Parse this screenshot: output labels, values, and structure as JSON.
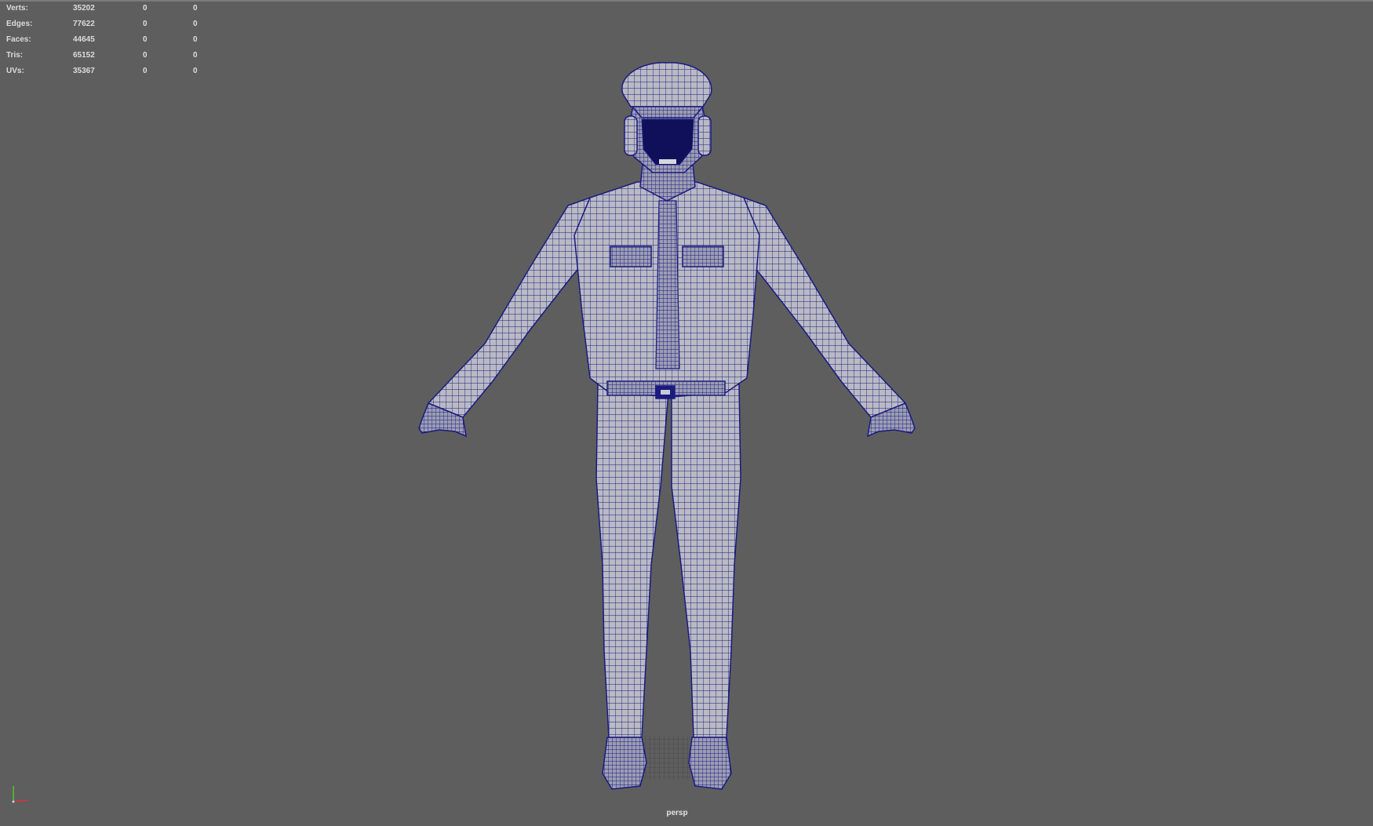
{
  "hud": {
    "rows": [
      {
        "label": "Verts:",
        "v1": "35202",
        "v2": "0",
        "v3": "0"
      },
      {
        "label": "Edges:",
        "v1": "77622",
        "v2": "0",
        "v3": "0"
      },
      {
        "label": "Faces:",
        "v1": "44645",
        "v2": "0",
        "v3": "0"
      },
      {
        "label": "Tris:",
        "v1": "65152",
        "v2": "0",
        "v3": "0"
      },
      {
        "label": "UVs:",
        "v1": "35367",
        "v2": "0",
        "v3": "0"
      }
    ]
  },
  "viewport": {
    "camera": "persp",
    "background_color": "#5e5e5e",
    "wire_color": "#1a1a80",
    "shade_color": "#b9bac3",
    "axis": {
      "y_color": "#59c42a",
      "x_color": "#d93434",
      "z_color": "#3a5bd6"
    }
  }
}
